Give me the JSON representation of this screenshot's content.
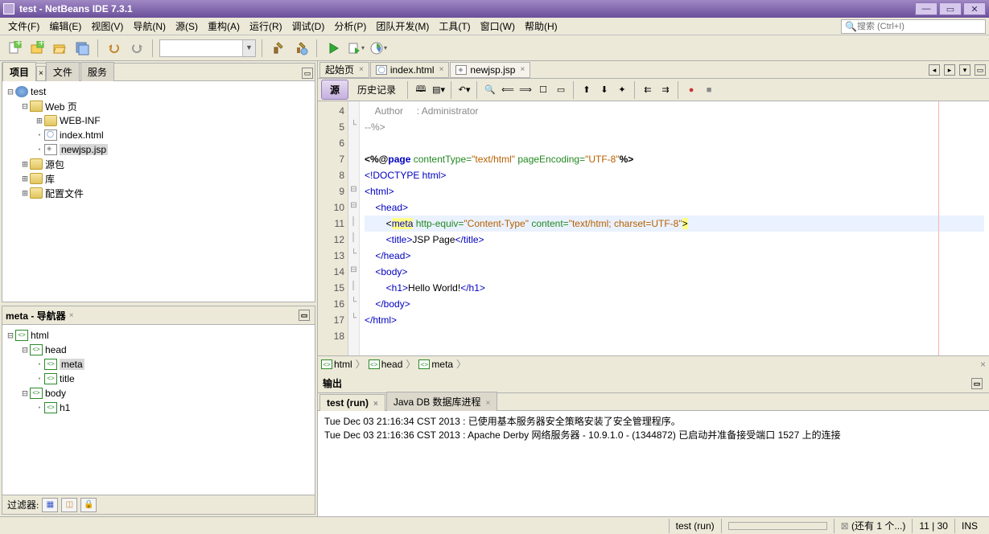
{
  "window": {
    "title": "test - NetBeans IDE 7.3.1"
  },
  "menu": [
    "文件(F)",
    "编辑(E)",
    "视图(V)",
    "导航(N)",
    "源(S)",
    "重构(A)",
    "运行(R)",
    "调试(D)",
    "分析(P)",
    "团队开发(M)",
    "工具(T)",
    "窗口(W)",
    "帮助(H)"
  ],
  "search_placeholder": "搜索 (Ctrl+I)",
  "project_panel": {
    "tabs": [
      "项目",
      "文件",
      "服务"
    ],
    "tree": {
      "root": "test",
      "web": "Web 页",
      "webinf": "WEB-INF",
      "index": "index.html",
      "newjsp": "newjsp.jsp",
      "src": "源包",
      "lib": "库",
      "conf": "配置文件"
    }
  },
  "navigator": {
    "title": "meta - 导航器",
    "nodes": {
      "html": "html",
      "head": "head",
      "meta": "meta",
      "title": "title",
      "body": "body",
      "h1": "h1"
    }
  },
  "filter_label": "过滤器:",
  "editor": {
    "tabs": [
      {
        "label": "起始页",
        "active": false,
        "icon": "home"
      },
      {
        "label": "index.html",
        "active": false,
        "icon": "html"
      },
      {
        "label": "newjsp.jsp",
        "active": true,
        "icon": "jsp"
      }
    ],
    "source_btn": "源",
    "history_btn": "历史记录",
    "gutter": [
      4,
      5,
      6,
      7,
      8,
      9,
      10,
      11,
      12,
      13,
      14,
      15,
      16,
      17,
      18
    ],
    "lines": {
      "l4": "    Author     : Administrator",
      "l5": "--%>",
      "l6": "",
      "l7a": "<%@",
      "l7b": "page",
      "l7c": " contentType=",
      "l7d": "\"text/html\"",
      "l7e": " pageEncoding=",
      "l7f": "\"UTF-8\"",
      "l7g": "%>",
      "l8": "<!DOCTYPE html>",
      "l9": "<html>",
      "l10": "    <head>",
      "l11a": "        <",
      "l11b": "meta",
      "l11c": " http-equiv=",
      "l11d": "\"Content-Type\"",
      "l11e": " content=",
      "l11f": "\"text/html; charset=UTF-8\"",
      "l11g": ">",
      "l12a": "        <title>",
      "l12b": "JSP Page",
      "l12c": "</title>",
      "l13": "    </head>",
      "l14": "    <body>",
      "l15a": "        <h1>",
      "l15b": "Hello World!",
      "l15c": "</h1>",
      "l16": "    </body>",
      "l17": "</html>",
      "l18": ""
    },
    "breadcrumb": [
      "html",
      "head",
      "meta"
    ]
  },
  "output": {
    "title": "输出",
    "tabs": [
      "test (run)",
      "Java DB 数据库进程"
    ],
    "lines": [
      "Tue Dec 03 21:16:34 CST 2013 : 已使用基本服务器安全策略安装了安全管理程序。",
      "Tue Dec 03 21:16:36 CST 2013 : Apache Derby 网络服务器 - 10.9.1.0 - (1344872) 已启动并准备接受端口 1527 上的连接"
    ]
  },
  "status": {
    "run": "test (run)",
    "more": "(还有 1 个...)",
    "pos": "11 | 30",
    "ins": "INS"
  }
}
